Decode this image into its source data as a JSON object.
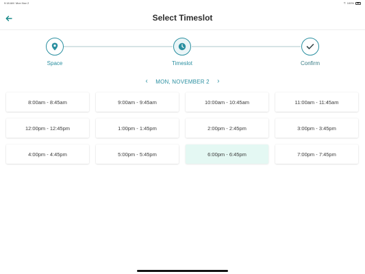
{
  "status_bar": {
    "time": "9:18 AM",
    "date": "Mon Nov 2",
    "battery": "100%"
  },
  "header": {
    "title": "Select Timeslot",
    "back_icon": "arrow-left-icon"
  },
  "stepper": {
    "steps": [
      {
        "label": "Space",
        "icon": "map-pin-icon"
      },
      {
        "label": "Timeslot",
        "icon": "clock-icon"
      },
      {
        "label": "Confirm",
        "icon": "checkmark-icon"
      }
    ],
    "active_index": 1
  },
  "date_nav": {
    "label": "MON, NOVEMBER 2",
    "prev_icon": "chevron-left-icon",
    "next_icon": "chevron-right-icon"
  },
  "timeslots": [
    "8:00am - 8:45am",
    "9:00am - 9:45am",
    "10:00am - 10:45am",
    "11:00am - 11:45am",
    "12:00pm - 12:45pm",
    "1:00pm - 1:45pm",
    "2:00pm - 2:45pm",
    "3:00pm - 3:45pm",
    "4:00pm - 4:45pm",
    "5:00pm - 5:45pm",
    "6:00pm - 6:45pm",
    "7:00pm - 7:45pm"
  ],
  "selected_timeslot_index": 10,
  "colors": {
    "accent": "#2a8fa0",
    "selected_slot_bg": "#e4f8f3",
    "back_arrow": "#1a8a8a"
  }
}
